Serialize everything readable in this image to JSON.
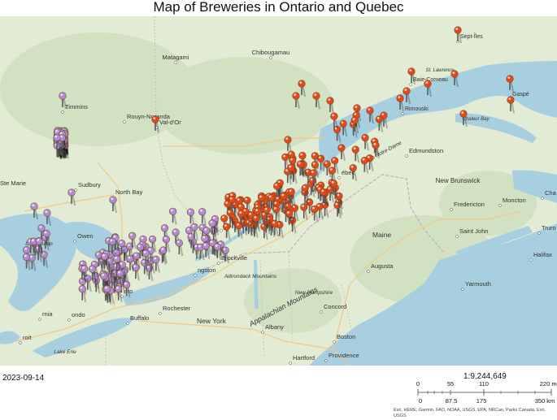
{
  "title": "Map of Breweries in Ontario and Quebec",
  "date": "2023-09-14",
  "scale": {
    "ratio": "1:9,244,649",
    "miles_ticks": [
      "0",
      "55",
      "110",
      "220 mi"
    ],
    "km_ticks": [
      "0",
      "87.5",
      "175",
      "350 km"
    ]
  },
  "attribution": "Esri, HERE, Garmin, FAO, NOAA, USGS, EPA, NRCan, Parks Canada, Esri, USGS",
  "places": [
    {
      "id": "sept-iles",
      "label": "Sept-Îles"
    },
    {
      "id": "baie-comeau",
      "label": "Baie-Comeau"
    },
    {
      "id": "gaspe",
      "label": "Gaspé"
    },
    {
      "id": "rimouski",
      "label": "Rimouski"
    },
    {
      "id": "chibougamau",
      "label": "Chibougamau"
    },
    {
      "id": "matagami",
      "label": "Matagami"
    },
    {
      "id": "timmins",
      "label": "Timmins"
    },
    {
      "id": "rouyn-noranda",
      "label": "Rouyn-Noranda"
    },
    {
      "id": "val-dor",
      "label": "Val-d'Or"
    },
    {
      "id": "edmundston",
      "label": "Edmundston"
    },
    {
      "id": "new-brunswick",
      "label": "New Brunswick"
    },
    {
      "id": "fredericton",
      "label": "Fredericton"
    },
    {
      "id": "moncton",
      "label": "Moncton"
    },
    {
      "id": "saint-john",
      "label": "Saint John"
    },
    {
      "id": "truro",
      "label": "Truro"
    },
    {
      "id": "halifax",
      "label": "Halifax"
    },
    {
      "id": "yarmouth",
      "label": "Yarmouth"
    },
    {
      "id": "maine",
      "label": "Maine"
    },
    {
      "id": "augusta",
      "label": "Augusta"
    },
    {
      "id": "concord",
      "label": "Concord"
    },
    {
      "id": "boston",
      "label": "Boston"
    },
    {
      "id": "providence",
      "label": "Providence"
    },
    {
      "id": "hartford",
      "label": "Hartford"
    },
    {
      "id": "albany",
      "label": "Albany"
    },
    {
      "id": "new-york",
      "label": "New York"
    },
    {
      "id": "rochester",
      "label": "Rochester"
    },
    {
      "id": "buffalo",
      "label": "Buffalo"
    },
    {
      "id": "north-bay",
      "label": "North Bay"
    },
    {
      "id": "sudbury",
      "label": "Sudbury"
    },
    {
      "id": "ste-marie",
      "label": "Ste Marie"
    },
    {
      "id": "kingston",
      "label": "ngston"
    },
    {
      "id": "brockville",
      "label": "Brockville"
    },
    {
      "id": "ottawa",
      "label": "wa"
    },
    {
      "id": "owen-sound",
      "label": "Owen"
    },
    {
      "id": "toronto",
      "label": "nto"
    },
    {
      "id": "london",
      "label": "ondo"
    },
    {
      "id": "sarnia",
      "label": "rnia"
    },
    {
      "id": "detroit",
      "label": "roit"
    },
    {
      "id": "quebec-city",
      "label": "ébec"
    },
    {
      "id": "trois-rivieres",
      "label": "ivières"
    },
    {
      "id": "new-hampshire",
      "label": "New Hampshire"
    },
    {
      "id": "adirondack",
      "label": "Adirondack Mountains"
    },
    {
      "id": "appalachian",
      "label": "Appalachian Mountains"
    },
    {
      "id": "monts-notre-dame",
      "label": "Monts Notre-Dame"
    },
    {
      "id": "lake-huron",
      "label": "Lake Huron"
    },
    {
      "id": "lake-erie",
      "label": "Lake Erie"
    },
    {
      "id": "st-lawrence",
      "label": "St. Lawrence"
    },
    {
      "id": "chaleur-bay",
      "label": "Chaleur Bay"
    },
    {
      "id": "halifax-2",
      "label": "Cha"
    }
  ],
  "markers": {
    "ontario_color": "#b38ad6",
    "quebec_color": "#e8471c",
    "ontario_count": 240,
    "quebec_count": 150
  },
  "colors": {
    "land": "#dfe8cf",
    "forest": "#cfe0c0",
    "water": "#a8cfe0",
    "road": "#f2c98a"
  }
}
